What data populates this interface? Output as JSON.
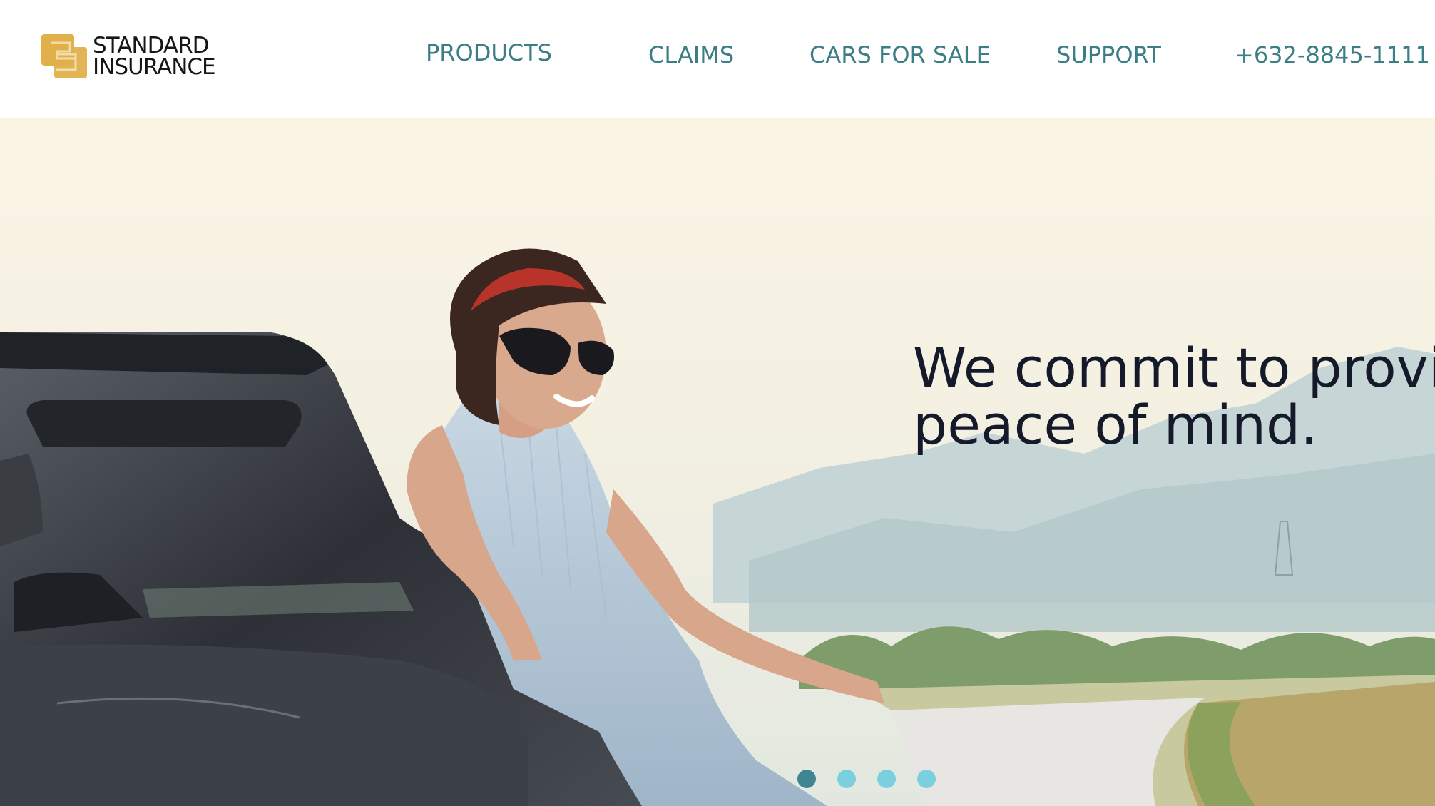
{
  "brand": {
    "line1": "STANDARD",
    "line2": "INSURANCE",
    "mark_color": "#e1b04b"
  },
  "nav": {
    "products": "PRODUCTS",
    "claims": "CLAIMS",
    "cars_for_sale": "CARS FOR SALE",
    "support": "SUPPORT",
    "phone": "+632-8845-1111"
  },
  "hero": {
    "headline_line1": "We commit to provic",
    "headline_line2": "peace of mind.",
    "slides_total": 4,
    "active_slide": 1
  },
  "colors": {
    "nav_text": "#3c7e86",
    "headline": "#151a2b",
    "dot": "#7ad0de",
    "dot_active": "#3f8592"
  }
}
